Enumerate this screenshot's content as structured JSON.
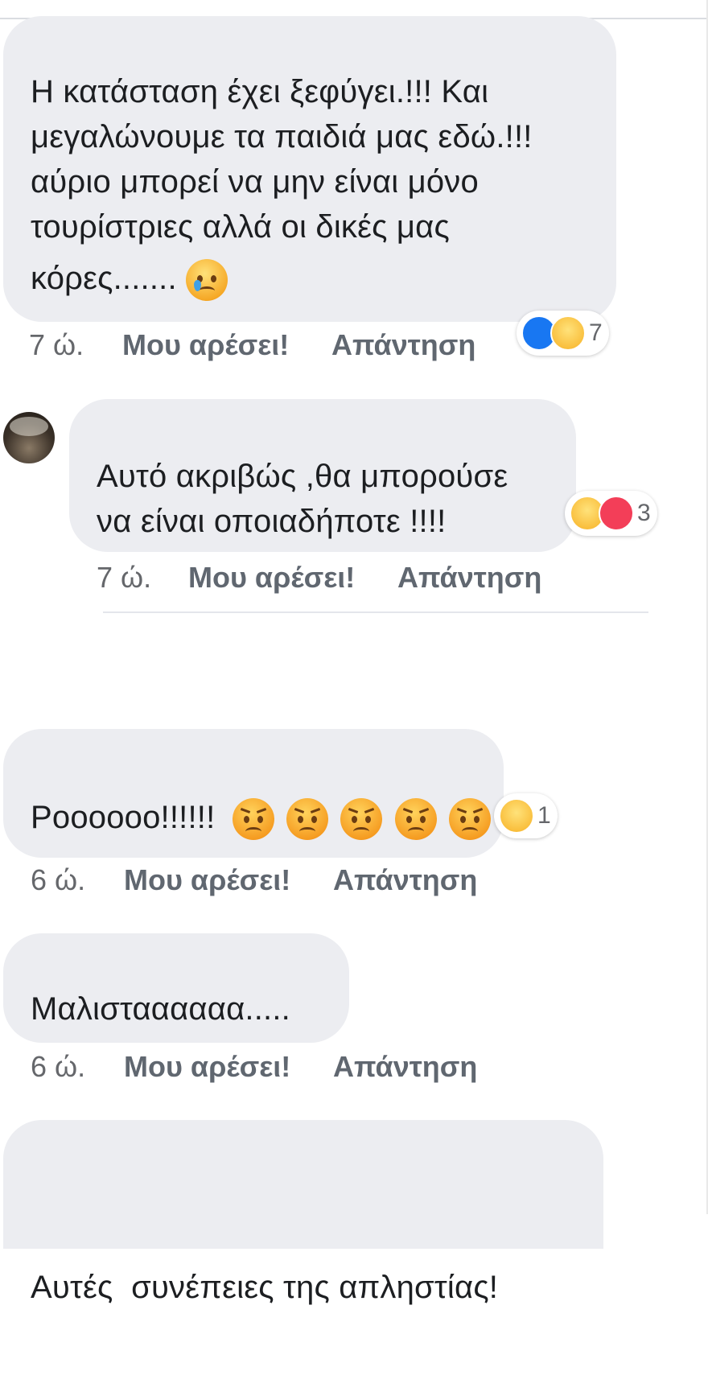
{
  "comments": [
    {
      "lines": [
        "Η κατάσταση έχει ξεφύγει.!!! Και",
        "μεγαλώνουμε τα παιδιά μας εδώ.!!!",
        "αύριο μπορεί να μην είναι μόνο",
        "τουρίστριες αλλά οι δικές μας",
        "κόρες......."
      ],
      "trailing_emoji": "crying-face",
      "time": "7 ώ.",
      "like_label": "Μου αρέσει!",
      "reply_label": "Απάντηση",
      "reactions": [
        "like",
        "sad"
      ],
      "reaction_count": "7"
    },
    {
      "lines": [
        "Αυτό ακριβώς ,θα μπορούσε",
        "να είναι οποιαδήποτε !!!!"
      ],
      "time": "7 ώ.",
      "like_label": "Μου αρέσει!",
      "reply_label": "Απάντηση",
      "reactions": [
        "sad",
        "love"
      ],
      "reaction_count": "3"
    },
    {
      "lines": [
        "Ροοοοοο!!!!!!"
      ],
      "trailing_emojis": [
        "angry-face",
        "angry-face",
        "angry-face",
        "angry-face",
        "angry-face"
      ],
      "time": "6 ώ.",
      "like_label": "Μου αρέσει!",
      "reply_label": "Απάντηση",
      "reactions": [
        "sad"
      ],
      "reaction_count": "1"
    },
    {
      "lines": [
        "Μαλισταααααα....."
      ],
      "time": "6 ώ.",
      "like_label": "Μου αρέσει!",
      "reply_label": "Απάντηση"
    },
    {
      "lines": [
        "Αυτές  συνέπειες της απληστίας!"
      ]
    }
  ],
  "colors": {
    "bubble": "#ecedf1",
    "meta_text": "#65676b",
    "like_blue": "#1877f2",
    "love_red": "#f33e58",
    "sad_yellow": "#f7b125"
  }
}
